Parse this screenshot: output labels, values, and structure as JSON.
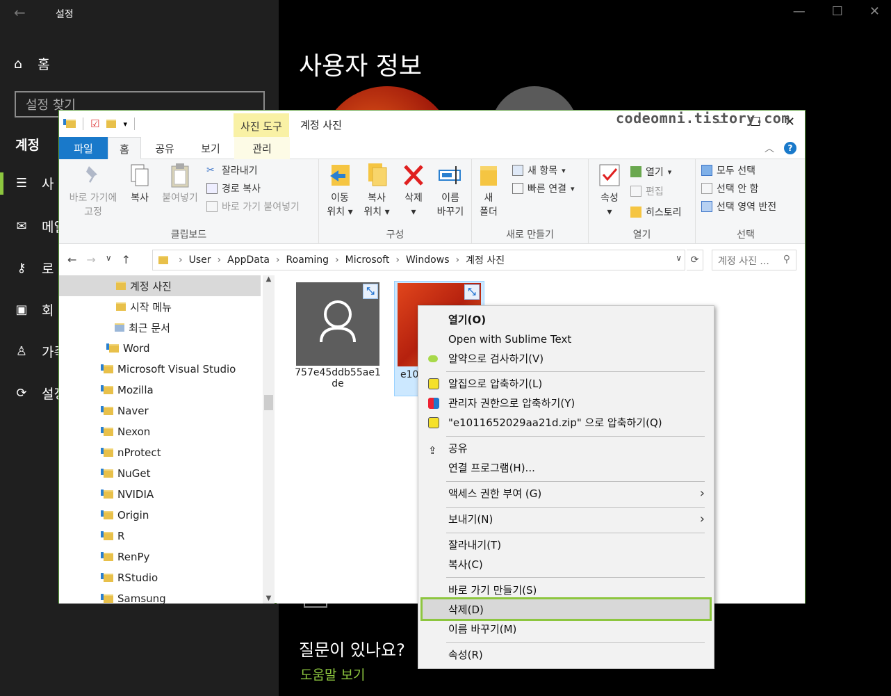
{
  "settings": {
    "window_title": "설정",
    "home_label": "홈",
    "search_placeholder": "설정 찾기",
    "section_heading": "계정",
    "nav_items": [
      "사",
      "메일",
      "로",
      "회",
      "가족",
      "설정"
    ],
    "page_title": "사용자 정보",
    "question_heading": "질문이 있나요?",
    "help_link": "도움말 보기"
  },
  "watermark": "codeomni.tistory.com",
  "explorer": {
    "window_title": "계정 사진",
    "context_tab": "사진 도구",
    "tabs": {
      "file": "파일",
      "home": "홈",
      "share": "공유",
      "view": "보기",
      "manage": "관리"
    },
    "ribbon": {
      "clipboard": {
        "label": "클립보드",
        "pin_line1": "바로 가기에",
        "pin_line2": "고정",
        "copy": "복사",
        "paste": "붙여넣기",
        "cut": "잘라내기",
        "copy_path": "경로 복사",
        "paste_shortcut": "바로 가기 붙여넣기"
      },
      "organize": {
        "label": "구성",
        "move_line1": "이동",
        "move_line2": "위치",
        "copyto_line1": "복사",
        "copyto_line2": "위치",
        "delete": "삭제",
        "rename_line1": "이름",
        "rename_line2": "바꾸기"
      },
      "new": {
        "label": "새로 만들기",
        "new_folder_line1": "새",
        "new_folder_line2": "폴더",
        "new_item": "새 항목",
        "easy_access": "빠른 연결"
      },
      "open": {
        "label": "열기",
        "properties": "속성",
        "open": "열기",
        "edit": "편집",
        "history": "히스토리"
      },
      "select": {
        "label": "선택",
        "select_all": "모두 선택",
        "select_none": "선택 안 함",
        "invert": "선택 영역 반전"
      }
    },
    "address": {
      "crumbs": [
        "User",
        "AppData",
        "Roaming",
        "Microsoft",
        "Windows",
        "계정 사진"
      ],
      "search_placeholder": "계정 사진 ..."
    },
    "nav_tree": [
      "계정 사진",
      "시작 메뉴",
      "최근 문서",
      "Word",
      "Microsoft Visual Studio",
      "Mozilla",
      "Naver",
      "Nexon",
      "nProtect",
      "NuGet",
      "NVIDIA",
      "Origin",
      "R",
      "RenPy",
      "RStudio",
      "Samsung"
    ],
    "files": [
      {
        "name_line1": "757e45ddb55ae1",
        "name_line2": "de"
      },
      {
        "name_line1": "e10"
      }
    ]
  },
  "context_menu": {
    "open": "열기(O)",
    "sublime": "Open with Sublime Text",
    "scan": "알약으로 검사하기(V)",
    "alzip": "알집으로 압축하기(L)",
    "admin_zip": "관리자 권한으로 압축하기(Y)",
    "zip_to": "\"e1011652029aa21d.zip\" 으로 압축하기(Q)",
    "share": "공유",
    "open_with": "연결 프로그램(H)...",
    "give_access": "액세스 권한 부여 (G)",
    "send_to": "보내기(N)",
    "cut": "잘라내기(T)",
    "copy": "복사(C)",
    "create_shortcut": "바로 가기 만들기(S)",
    "delete": "삭제(D)",
    "rename": "이름 바꾸기(M)",
    "properties": "속성(R)"
  },
  "colors": {
    "accent_green": "#8dc63f",
    "explorer_blue": "#1979ca",
    "context_tab_yellow": "#f9f1a5"
  }
}
